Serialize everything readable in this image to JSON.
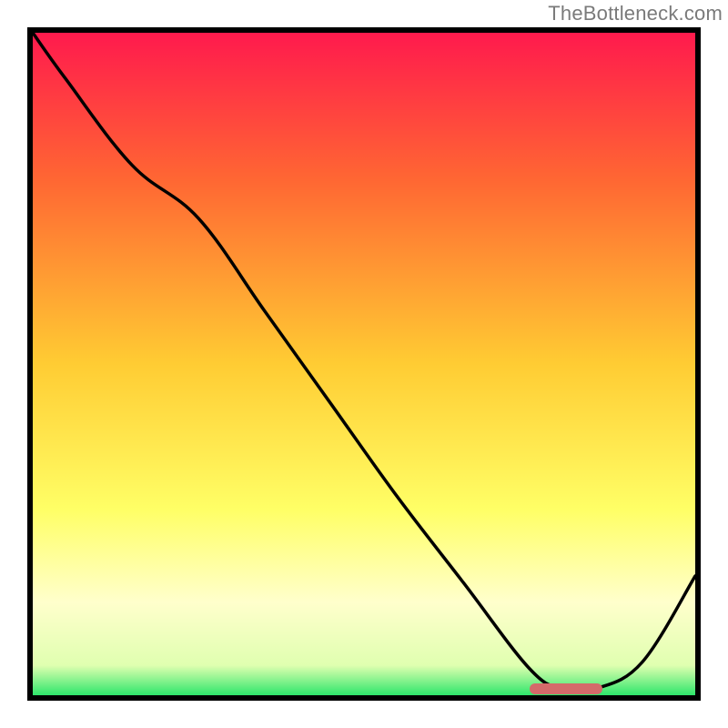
{
  "attribution": "TheBottleneck.com",
  "colors": {
    "gradient_top": "#ff1a4d",
    "gradient_upper_mid": "#ff6633",
    "gradient_mid": "#ffcc33",
    "gradient_lower_mid": "#ffff66",
    "gradient_pale_yellow": "#ffffcc",
    "gradient_bottom": "#2ee66b",
    "curve": "#000000",
    "marker": "#d46a6a",
    "border": "#000000"
  },
  "chart_data": {
    "type": "line",
    "title": "",
    "xlabel": "",
    "ylabel": "",
    "xlim": [
      0,
      100
    ],
    "ylim": [
      0,
      100
    ],
    "grid": false,
    "legend": false,
    "series": [
      {
        "name": "curve",
        "x": [
          0,
          5,
          15,
          25,
          35,
          45,
          55,
          65,
          75,
          80,
          85,
          92,
          100
        ],
        "y": [
          100,
          93,
          80,
          72,
          58,
          44,
          30,
          17,
          4,
          1,
          1,
          5,
          18
        ]
      }
    ],
    "marker": {
      "x_start": 75,
      "x_end": 86,
      "y": 1
    },
    "gradient_stops": [
      {
        "pos": 0.0,
        "color": "#ff1a4d"
      },
      {
        "pos": 0.22,
        "color": "#ff6633"
      },
      {
        "pos": 0.5,
        "color": "#ffcc33"
      },
      {
        "pos": 0.72,
        "color": "#ffff66"
      },
      {
        "pos": 0.86,
        "color": "#ffffcc"
      },
      {
        "pos": 0.955,
        "color": "#e0ffb0"
      },
      {
        "pos": 1.0,
        "color": "#2ee66b"
      }
    ]
  }
}
